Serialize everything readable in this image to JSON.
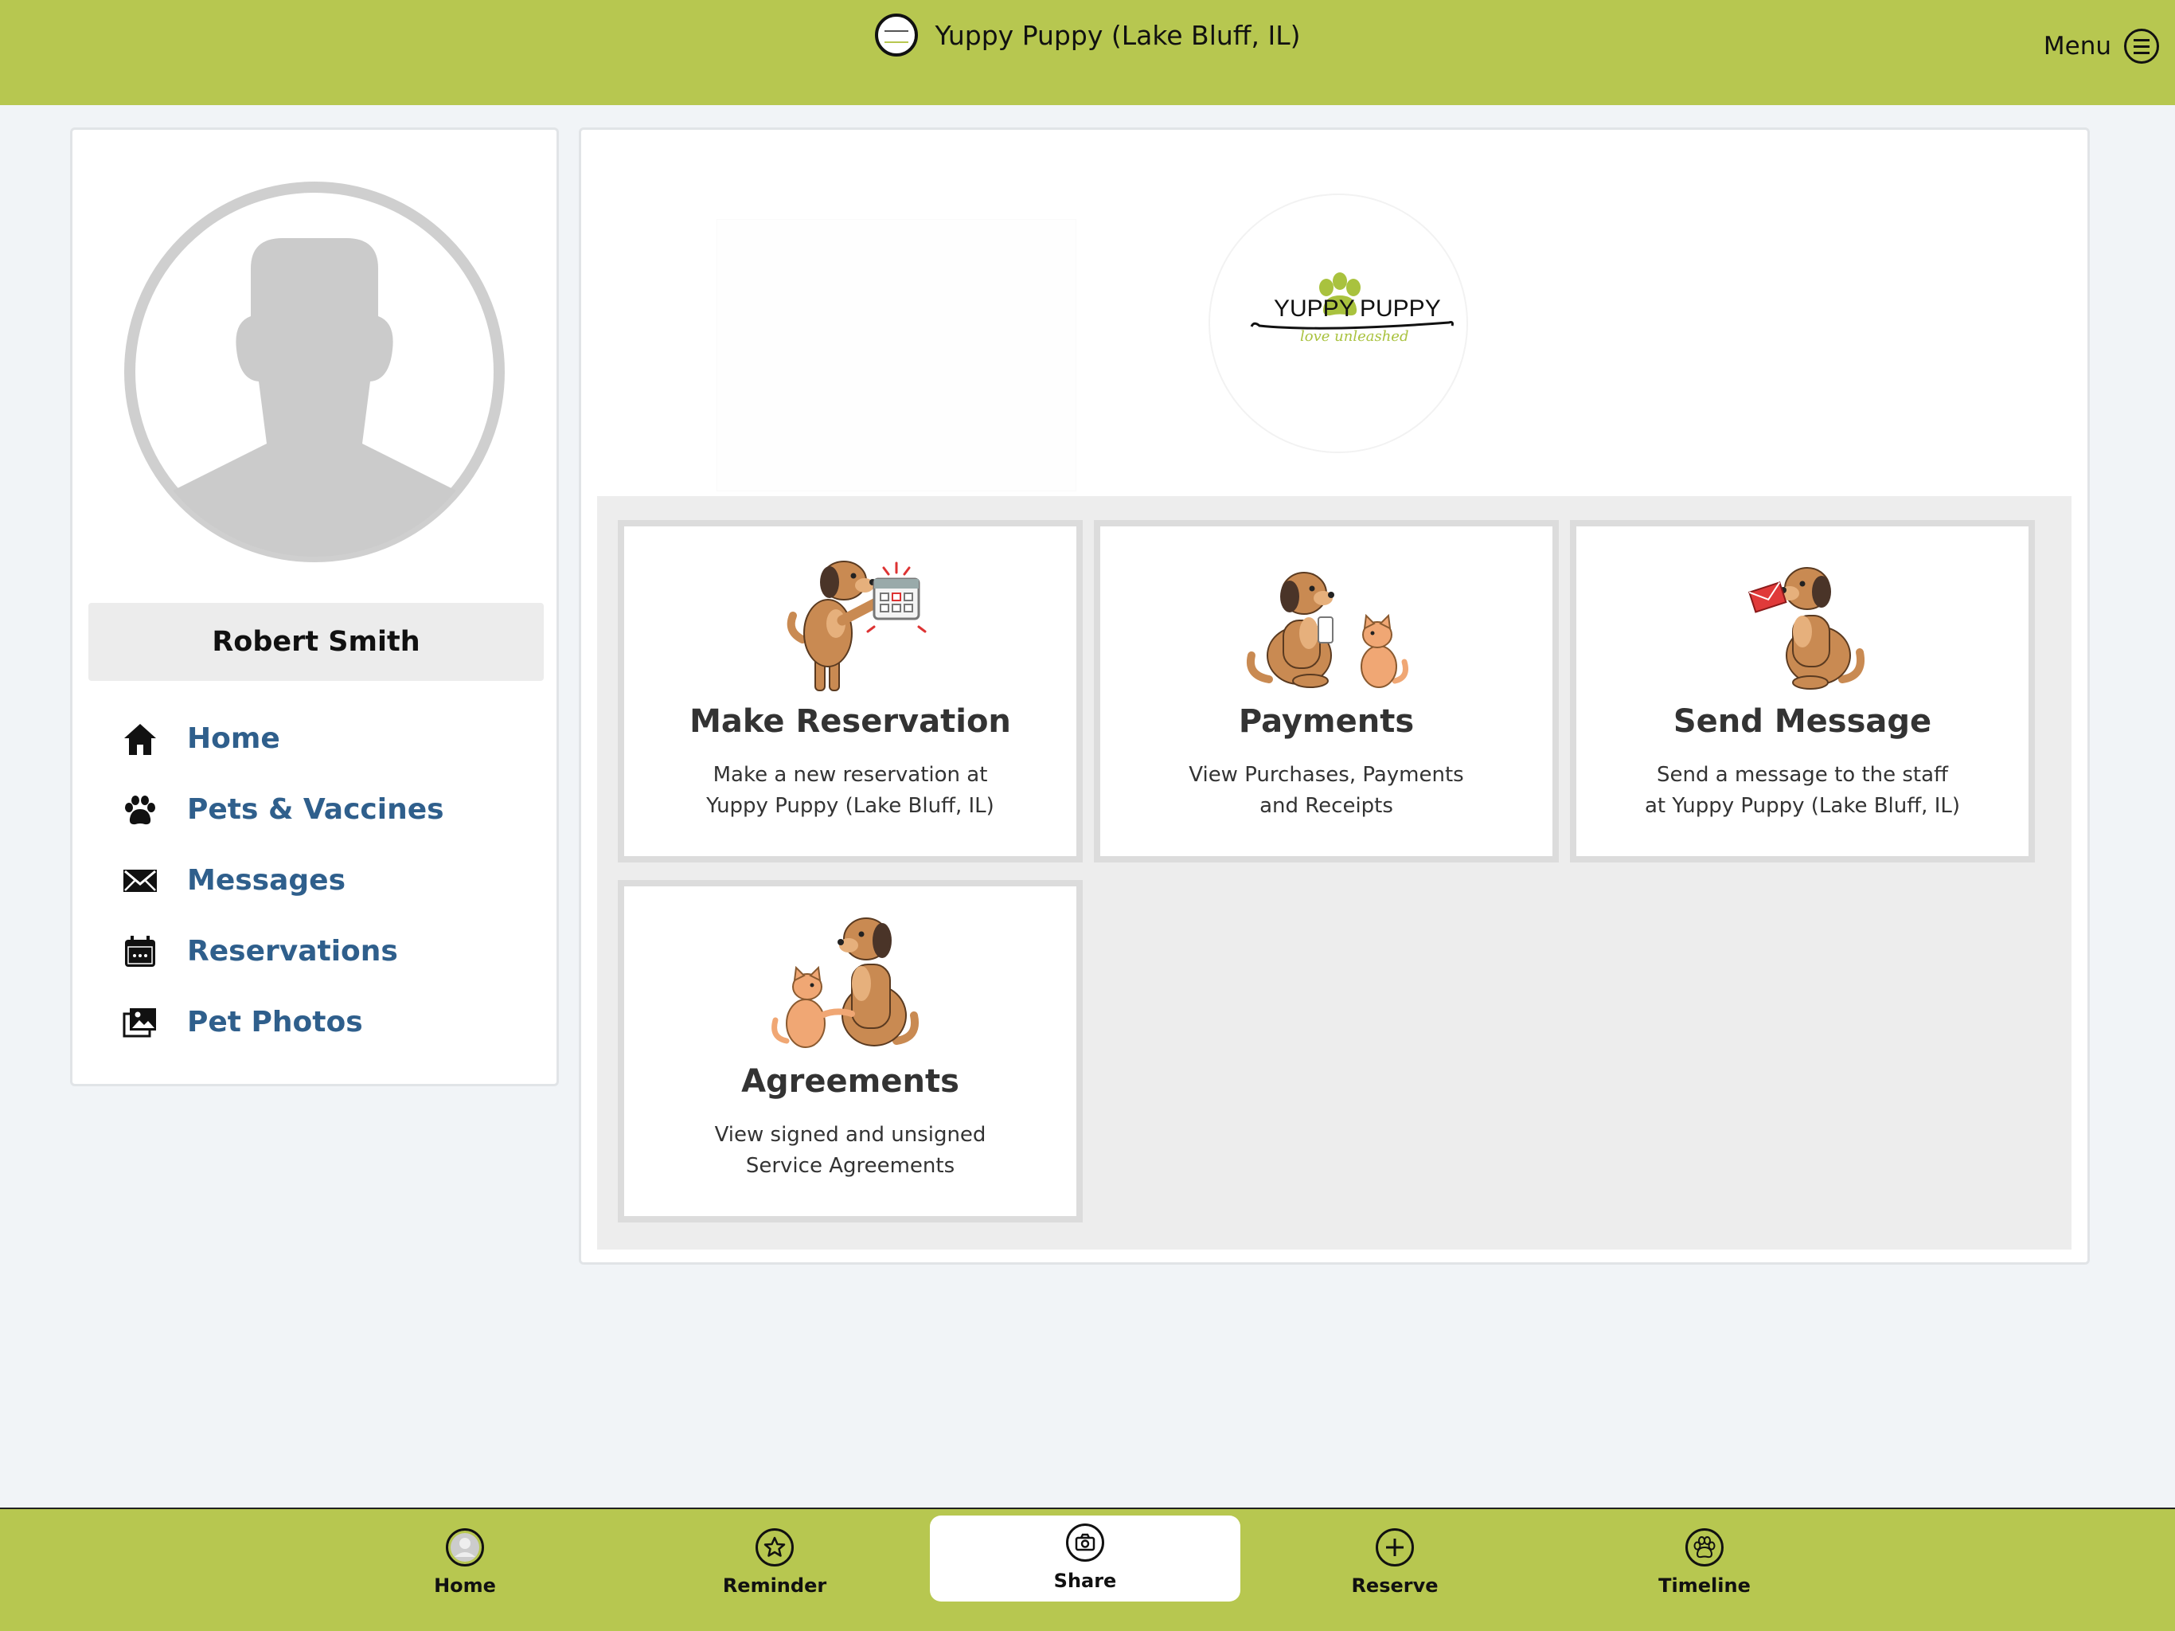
{
  "header": {
    "title": "Yuppy Puppy (Lake Bluff, IL)",
    "menu_label": "Menu"
  },
  "profile": {
    "name": "Robert Smith"
  },
  "sidebar": {
    "items": [
      {
        "label": "Home",
        "icon": "home-icon"
      },
      {
        "label": "Pets & Vaccines",
        "icon": "paw-icon"
      },
      {
        "label": "Messages",
        "icon": "envelope-icon"
      },
      {
        "label": "Reservations",
        "icon": "calendar-icon"
      },
      {
        "label": "Pet Photos",
        "icon": "photos-icon"
      }
    ]
  },
  "brand": {
    "logo_text_left": "YUPPY",
    "logo_text_right": "PUPPY",
    "logo_tagline": "love unleashed"
  },
  "tiles": [
    {
      "title": "Make Reservation",
      "desc_line1": "Make a new reservation at",
      "desc_line2": "Yuppy Puppy (Lake Bluff, IL)"
    },
    {
      "title": "Payments",
      "desc_line1": "View Purchases, Payments",
      "desc_line2": "and Receipts"
    },
    {
      "title": "Send Message",
      "desc_line1": "Send a message to the staff",
      "desc_line2": "at Yuppy Puppy (Lake Bluff, IL)"
    },
    {
      "title": "Agreements",
      "desc_line1": "View signed and unsigned",
      "desc_line2": "Service Agreements"
    }
  ],
  "tabbar": {
    "tabs": [
      {
        "label": "Home",
        "icon": "profile-icon"
      },
      {
        "label": "Reminder",
        "icon": "star-icon"
      },
      {
        "label": "Share",
        "icon": "camera-icon",
        "active": true
      },
      {
        "label": "Reserve",
        "icon": "plus-icon"
      },
      {
        "label": "Timeline",
        "icon": "paw-circle-icon"
      }
    ]
  },
  "colors": {
    "bar_green": "#b7c750",
    "link_blue": "#2f5f8c",
    "dog_brown": "#c98a52",
    "cat_orange": "#f0a774"
  }
}
